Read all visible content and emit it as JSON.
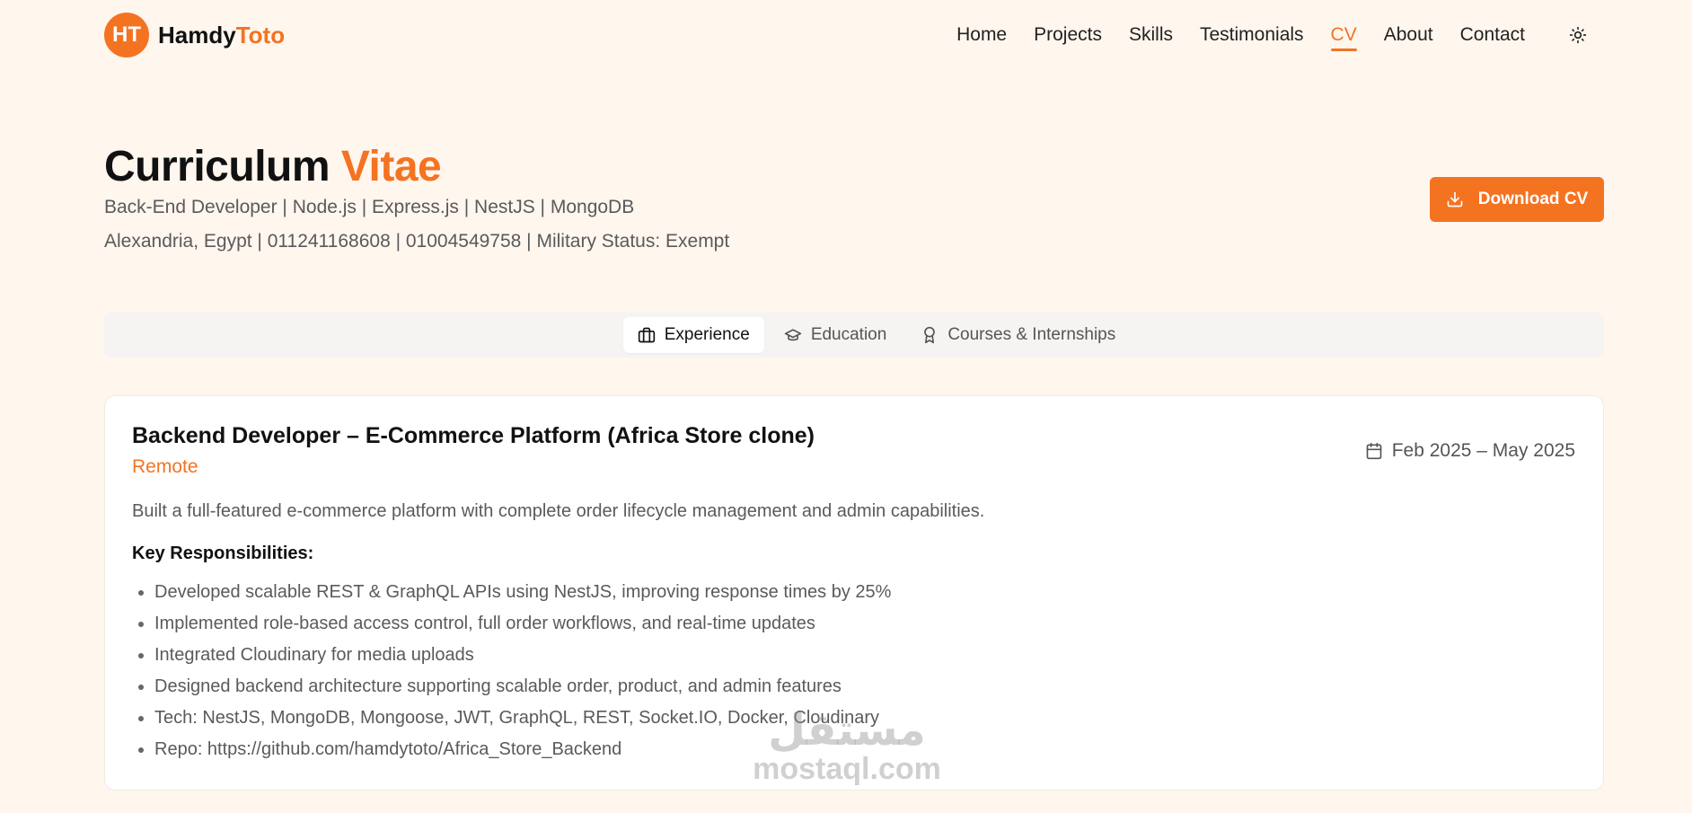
{
  "brand": {
    "initials": "HT",
    "name_main": "Hamdy",
    "name_accent": "Toto"
  },
  "nav": {
    "items": [
      {
        "label": "Home"
      },
      {
        "label": "Projects"
      },
      {
        "label": "Skills"
      },
      {
        "label": "Testimonials"
      },
      {
        "label": "CV",
        "active": true
      },
      {
        "label": "About"
      },
      {
        "label": "Contact"
      }
    ],
    "theme_icon": "sun-icon"
  },
  "hero": {
    "title_main": "Curriculum",
    "title_accent": "Vitae",
    "subtitle": "Back-End Developer | Node.js | Express.js | NestJS | MongoDB",
    "contact": "Alexandria, Egypt | 011241168608 | 01004549758 | Military Status: Exempt",
    "download_label": "Download CV",
    "download_icon": "download-icon"
  },
  "tabs": [
    {
      "label": "Experience",
      "icon": "briefcase-icon",
      "active": true
    },
    {
      "label": "Education",
      "icon": "graduation-cap-icon"
    },
    {
      "label": "Courses & Internships",
      "icon": "award-icon"
    }
  ],
  "experience": {
    "title": "Backend Developer – E-Commerce Platform (Africa Store clone)",
    "location": "Remote",
    "date": "Feb 2025 – May 2025",
    "date_icon": "calendar-icon",
    "description": "Built a full-featured e-commerce platform with complete order lifecycle management and admin capabilities.",
    "responsibilities_heading": "Key Responsibilities:",
    "responsibilities": [
      "Developed scalable REST & GraphQL APIs using NestJS, improving response times by 25%",
      "Implemented role-based access control, full order workflows, and real-time updates",
      "Integrated Cloudinary for media uploads",
      "Designed backend architecture supporting scalable order, product, and admin features",
      "Tech: NestJS, MongoDB, Mongoose, JWT, GraphQL, REST, Socket.IO, Docker, Cloudinary",
      "Repo: https://github.com/hamdytoto/Africa_Store_Backend"
    ]
  },
  "watermark": {
    "arabic": "مستقل",
    "latin": "mostaql.com"
  },
  "colors": {
    "accent": "#f47321",
    "background": "#fff6ee"
  }
}
